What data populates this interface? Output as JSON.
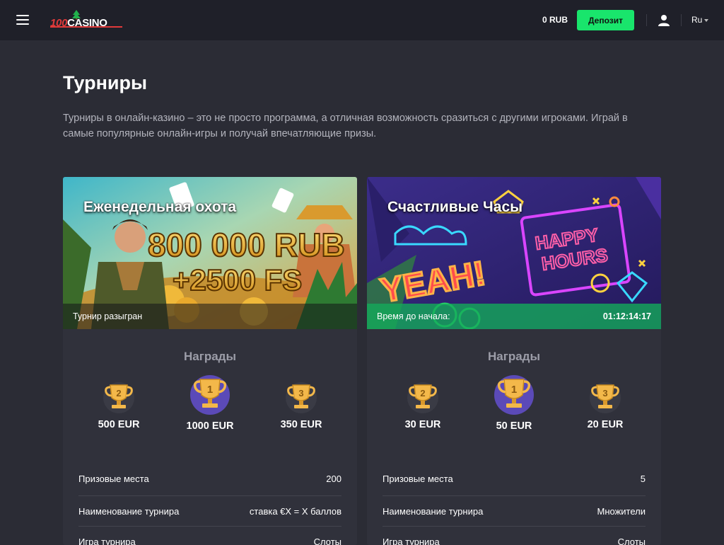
{
  "header": {
    "logo_num": "100",
    "logo_word": "CASINO",
    "balance": "0 RUB",
    "deposit_label": "Депозит",
    "lang": "Ru"
  },
  "page": {
    "title": "Турниры",
    "intro": "Турниры в онлайн-казино – это не просто программа, а отличная возможность сразиться с другими игроками. Играй в самые популярные онлайн-игры и получай впечатляющие призы."
  },
  "colors": {
    "accent_green": "#19e56c",
    "bg": "#2b2c35",
    "card": "#30313b",
    "topbar": "#1f2029"
  },
  "tournaments": [
    {
      "title": "Еженедельная охота",
      "banner_line1": "800 000 RUB",
      "banner_line2": "+2500 FS",
      "status": "Турнир разыгран",
      "timer": "",
      "rewards_title": "Награды",
      "prizes": [
        {
          "place": "2",
          "amount": "500 EUR"
        },
        {
          "place": "1",
          "amount": "1000 EUR"
        },
        {
          "place": "3",
          "amount": "350 EUR"
        }
      ],
      "rows": [
        {
          "label": "Призовые места",
          "value": "200"
        },
        {
          "label": "Наименование турнира",
          "value": "ставка €X = X баллов"
        },
        {
          "label": "Игра турнира",
          "value": "Слоты"
        }
      ]
    },
    {
      "title": "Счастливые Часы",
      "banner_neon1": "HAPPY",
      "banner_neon2": "HOURS",
      "banner_neon3": "YEAH!",
      "status": "Время до начала:",
      "timer": "01:12:14:17",
      "rewards_title": "Награды",
      "prizes": [
        {
          "place": "2",
          "amount": "30 EUR"
        },
        {
          "place": "1",
          "amount": "50 EUR"
        },
        {
          "place": "3",
          "amount": "20 EUR"
        }
      ],
      "rows": [
        {
          "label": "Призовые места",
          "value": "5"
        },
        {
          "label": "Наименование турнира",
          "value": "Множители"
        },
        {
          "label": "Игра турнира",
          "value": "Слоты"
        }
      ]
    }
  ]
}
